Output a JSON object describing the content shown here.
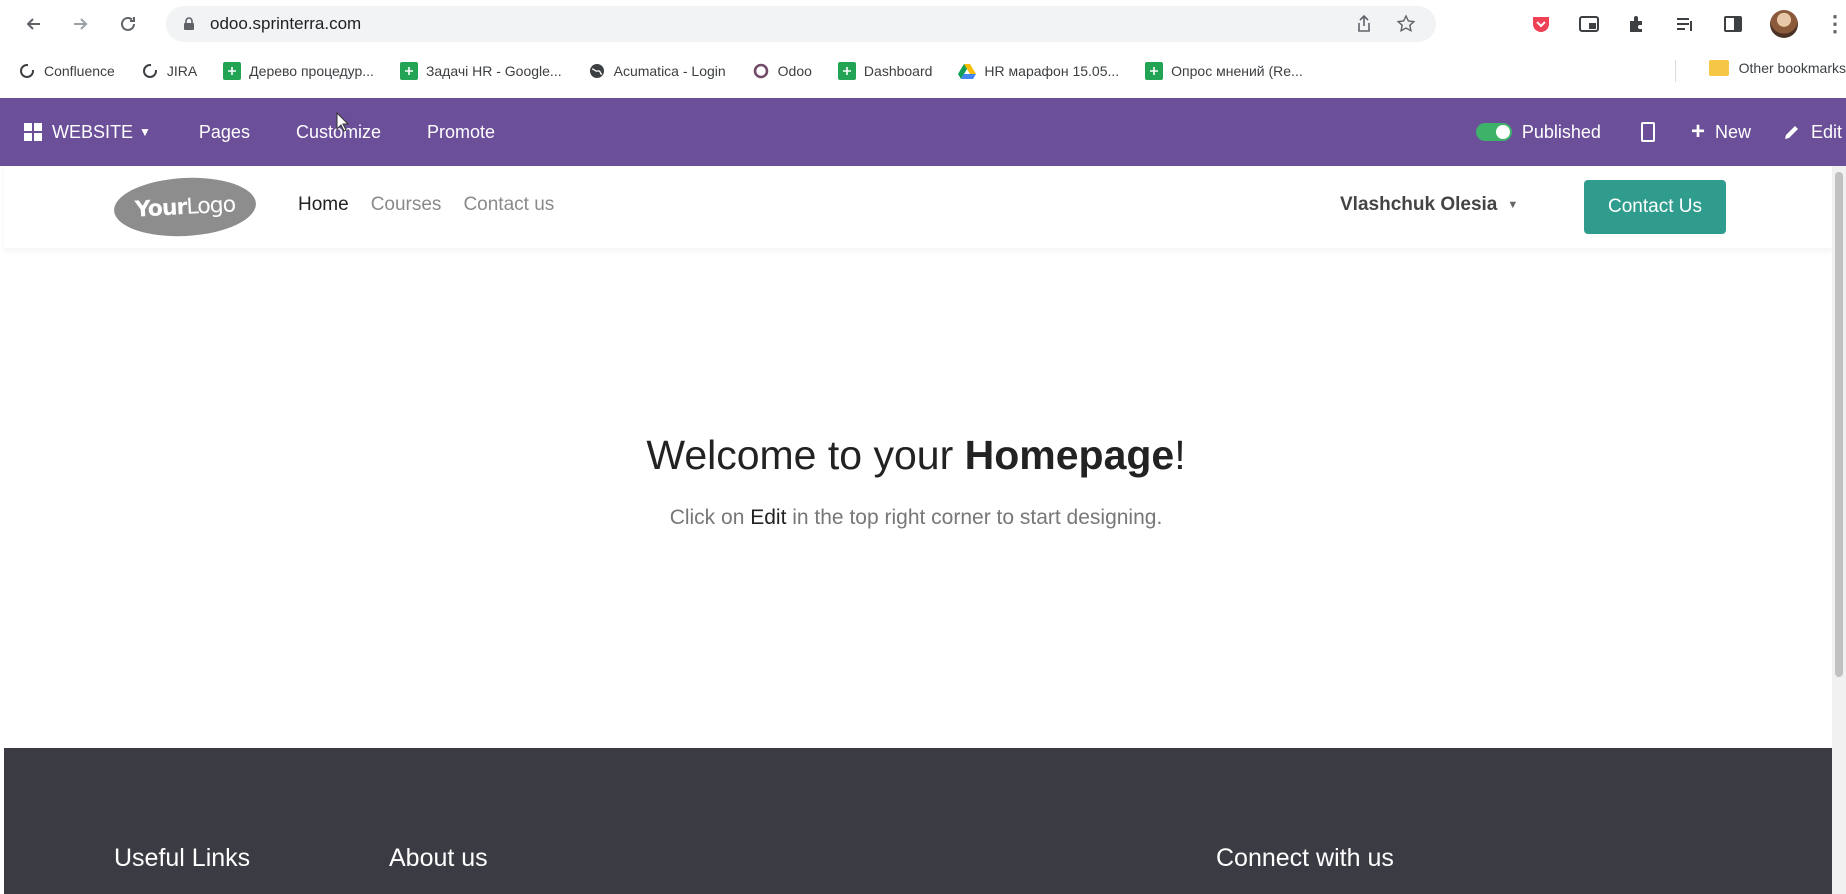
{
  "browser": {
    "url": "odoo.sprinterra.com",
    "bookmarks": [
      {
        "label": "Confluence",
        "icon": "confluence-icon"
      },
      {
        "label": "JIRA",
        "icon": "jira-icon"
      },
      {
        "label": "Дерево процедур...",
        "icon": "sheets-icon"
      },
      {
        "label": "Задачі HR - Google...",
        "icon": "sheets-icon"
      },
      {
        "label": "Acumatica - Login",
        "icon": "globe-icon"
      },
      {
        "label": "Odoo",
        "icon": "odoo-icon"
      },
      {
        "label": "Dashboard",
        "icon": "sheets-icon"
      },
      {
        "label": "HR марафон 15.05...",
        "icon": "drive-icon"
      },
      {
        "label": "Опрос мнений (Re...",
        "icon": "sheets-icon"
      }
    ],
    "other_bookmarks": "Other bookmarks"
  },
  "odoo_bar": {
    "app": "WEBSITE",
    "menu": [
      "Pages",
      "Customize",
      "Promote"
    ],
    "published": "Published",
    "new": "New",
    "edit": "Edit",
    "accent": "#6b4f99"
  },
  "site_header": {
    "logo_bold": "Your",
    "logo_thin": "Logo",
    "nav": [
      "Home",
      "Courses",
      "Contact us"
    ],
    "user": "Vlashchuk Olesia",
    "cta": "Contact Us",
    "cta_color": "#2f9c8e"
  },
  "hero": {
    "title_pre": "Welcome to your ",
    "title_bold": "Homepage",
    "title_post": "!",
    "sub_pre": "Click on ",
    "sub_bold": "Edit",
    "sub_post": " in the top right corner to start designing."
  },
  "footer": {
    "columns": [
      "Useful Links",
      "About us",
      "Connect with us"
    ]
  }
}
